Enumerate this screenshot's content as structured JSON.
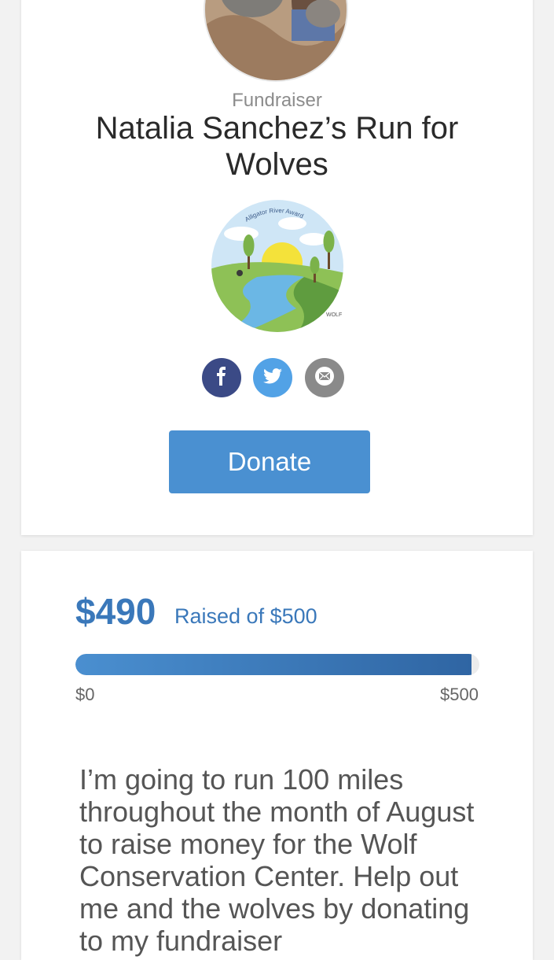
{
  "fundraiser": {
    "kind_label": "Fundraiser",
    "title": "Natalia Sanchez’s Run for Wolves",
    "badge_text": "Alligator River Award",
    "badge_mark": "WOLF"
  },
  "share": {
    "facebook_icon": "facebook-icon",
    "twitter_icon": "twitter-icon",
    "email_icon": "email-icon"
  },
  "donate_label": "Donate",
  "progress": {
    "raised": "$490",
    "raised_of": "Raised of $500",
    "min_label": "$0",
    "max_label": "$500",
    "fraction": 0.98
  },
  "story": "I’m going to run 100 miles throughout the month of August to raise money for the Wolf Conservation Center. Help out me and the wolves by donating to my fundraiser",
  "colors": {
    "accent": "#4a90d1",
    "amount": "#3a78ba",
    "facebook": "#3b4a86",
    "twitter": "#52a2e6",
    "email": "#8a8a8a"
  }
}
